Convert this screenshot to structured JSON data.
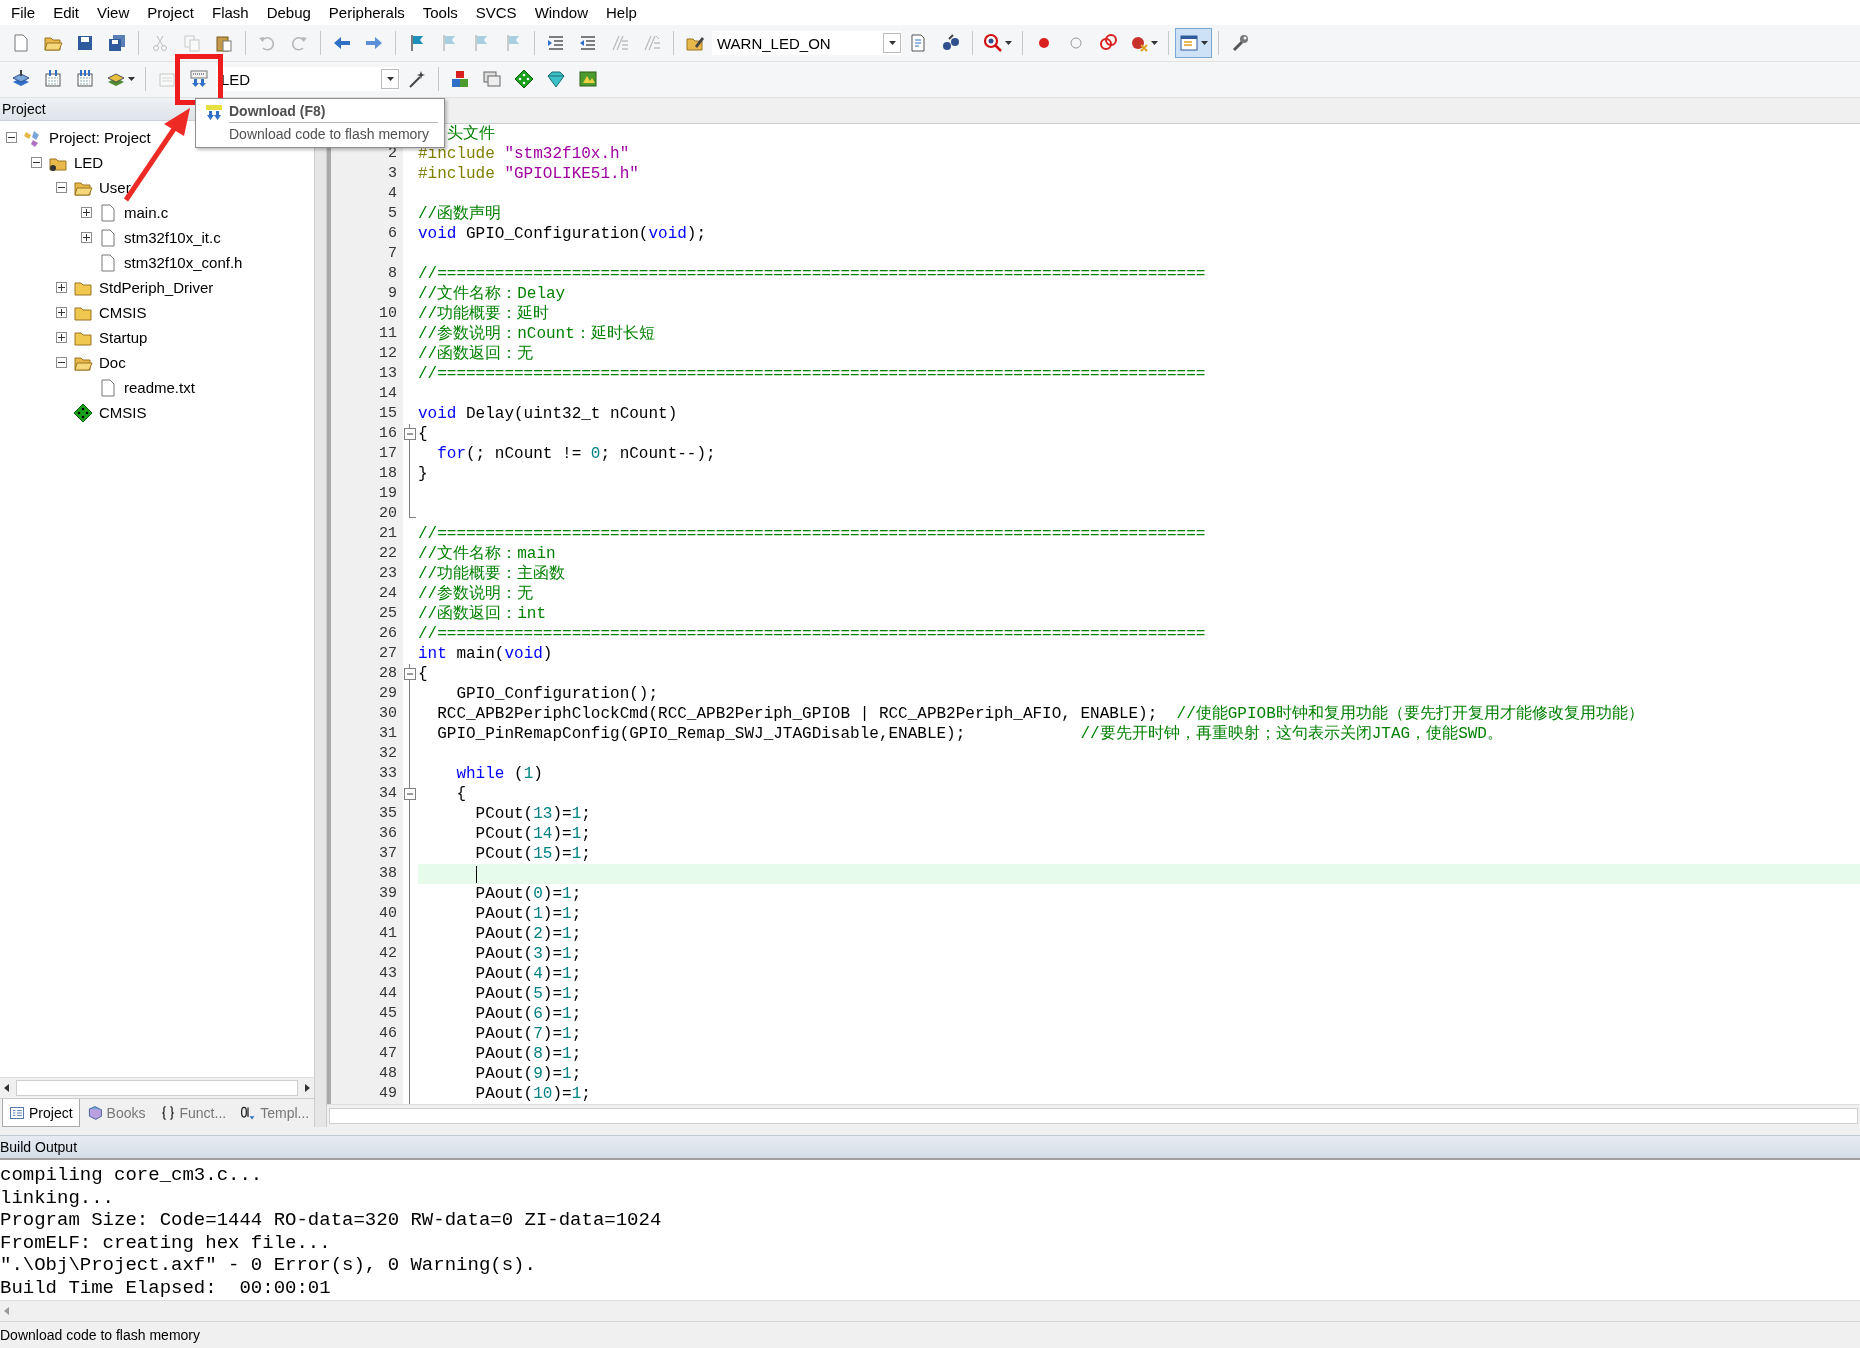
{
  "menu": [
    "File",
    "Edit",
    "View",
    "Project",
    "Flash",
    "Debug",
    "Peripherals",
    "Tools",
    "SVCS",
    "Window",
    "Help"
  ],
  "toolbar_1": [
    {
      "kind": "button",
      "disabled": false
    },
    {
      "kind": "button",
      "disabled": false
    },
    {
      "kind": "button",
      "disabled": false
    },
    {
      "kind": "button",
      "disabled": false
    },
    {
      "kind": "separator"
    },
    {
      "kind": "button",
      "disabled": true
    },
    {
      "kind": "button",
      "disabled": true
    },
    {
      "kind": "button",
      "disabled": false
    },
    {
      "kind": "separator"
    },
    {
      "kind": "button",
      "disabled": true
    },
    {
      "kind": "button",
      "disabled": true
    },
    {
      "kind": "separator"
    },
    {
      "kind": "button",
      "disabled": false
    },
    {
      "kind": "button",
      "disabled": false
    },
    {
      "kind": "separator"
    },
    {
      "kind": "button",
      "disabled": false
    },
    {
      "kind": "button",
      "disabled": true
    },
    {
      "kind": "button",
      "disabled": true
    },
    {
      "kind": "button",
      "disabled": true
    },
    {
      "kind": "separator"
    },
    {
      "kind": "button",
      "disabled": false
    },
    {
      "kind": "button",
      "disabled": false
    },
    {
      "kind": "button",
      "disabled": true
    },
    {
      "kind": "button",
      "disabled": true
    },
    {
      "kind": "separator"
    },
    {
      "kind": "button",
      "disabled": false
    },
    {
      "kind": "combo",
      "value": "WARN_LED_ON"
    },
    {
      "kind": "button",
      "disabled": false
    },
    {
      "kind": "button",
      "disabled": false
    },
    {
      "kind": "separator"
    },
    {
      "kind": "menu-button",
      "disabled": false
    },
    {
      "kind": "separator"
    },
    {
      "kind": "button",
      "disabled": false
    },
    {
      "kind": "button",
      "disabled": false
    },
    {
      "kind": "button",
      "disabled": false
    },
    {
      "kind": "menu-button",
      "disabled": false
    },
    {
      "kind": "separator"
    },
    {
      "kind": "menu-button",
      "disabled": false,
      "pressed": true
    },
    {
      "kind": "separator"
    },
    {
      "kind": "button",
      "disabled": false
    }
  ],
  "toolbar_2": [
    {
      "kind": "button",
      "disabled": false
    },
    {
      "kind": "button",
      "disabled": false
    },
    {
      "kind": "button",
      "disabled": false
    },
    {
      "kind": "menu-button",
      "disabled": false
    },
    {
      "kind": "separator"
    },
    {
      "kind": "button",
      "disabled": true
    },
    {
      "kind": "button",
      "disabled": false,
      "highlighted": true
    },
    {
      "kind": "combo",
      "value": "LED"
    },
    {
      "kind": "button",
      "disabled": false
    },
    {
      "kind": "separator"
    },
    {
      "kind": "button",
      "disabled": false
    },
    {
      "kind": "button",
      "disabled": false
    },
    {
      "kind": "button",
      "disabled": false
    },
    {
      "kind": "button",
      "disabled": false
    },
    {
      "kind": "button",
      "disabled": false
    }
  ],
  "tooltip": {
    "title": "Download (F8)",
    "description": "Download code to flash memory"
  },
  "annotation_arrow": true,
  "project_panel": {
    "title": "Project",
    "tree": [
      {
        "label": "Project: Project",
        "kind": "project",
        "expanded": true,
        "children": [
          {
            "label": "LED",
            "kind": "target",
            "expanded": true,
            "children": [
              {
                "label": "User",
                "kind": "group",
                "expanded": true,
                "children": [
                  {
                    "label": "main.c",
                    "kind": "file",
                    "expanded": false
                  },
                  {
                    "label": "stm32f10x_it.c",
                    "kind": "file",
                    "expanded": false
                  },
                  {
                    "label": "stm32f10x_conf.h",
                    "kind": "file"
                  }
                ]
              },
              {
                "label": "StdPeriph_Driver",
                "kind": "group",
                "expanded": false
              },
              {
                "label": "CMSIS",
                "kind": "group",
                "expanded": false
              },
              {
                "label": "Startup",
                "kind": "group",
                "expanded": false
              },
              {
                "label": "Doc",
                "kind": "group",
                "expanded": true,
                "children": [
                  {
                    "label": "readme.txt",
                    "kind": "file"
                  }
                ]
              },
              {
                "label": "CMSIS",
                "kind": "component"
              }
            ]
          }
        ]
      }
    ],
    "tabs": [
      {
        "label": "Project",
        "selected": true
      },
      {
        "label": "Books",
        "selected": false
      },
      {
        "label": "Funct...",
        "selected": false
      },
      {
        "label": "Templ...",
        "selected": false
      }
    ]
  },
  "editor": {
    "lines": [
      {
        "tokens": [
          {
            "kind": "comment",
            "text": "头文件"
          }
        ]
      },
      {
        "number": "2",
        "tokens": [
          {
            "kind": "preproc",
            "text": "#include"
          },
          {
            "kind": "string",
            "text": " \"stm32f10x.h\""
          }
        ]
      },
      {
        "number": "3",
        "tokens": [
          {
            "kind": "preproc",
            "text": "#include"
          },
          {
            "kind": "string",
            "text": " \"GPIOLIKE51.h\""
          }
        ]
      },
      {
        "number": "4"
      },
      {
        "number": "5",
        "tokens": [
          {
            "kind": "comment",
            "text": "//函数声明"
          }
        ]
      },
      {
        "number": "6",
        "tokens": [
          {
            "kind": "keyword",
            "text": "void"
          },
          {
            "kind": "plain",
            "text": " GPIO_Configuration("
          },
          {
            "kind": "keyword",
            "text": "void"
          },
          {
            "kind": "plain",
            "text": ");"
          }
        ]
      },
      {
        "number": "7"
      },
      {
        "number": "8",
        "tokens": [
          {
            "kind": "comment",
            "text": "//================================================================================"
          }
        ]
      },
      {
        "number": "9",
        "tokens": [
          {
            "kind": "comment",
            "text": "//文件名称：Delay"
          }
        ]
      },
      {
        "number": "10",
        "tokens": [
          {
            "kind": "comment",
            "text": "//功能概要：延时"
          }
        ]
      },
      {
        "number": "11",
        "tokens": [
          {
            "kind": "comment",
            "text": "//参数说明：nCount：延时长短"
          }
        ]
      },
      {
        "number": "12",
        "tokens": [
          {
            "kind": "comment",
            "text": "//函数返回：无"
          }
        ]
      },
      {
        "number": "13",
        "tokens": [
          {
            "kind": "comment",
            "text": "//================================================================================"
          }
        ]
      },
      {
        "number": "14"
      },
      {
        "number": "15",
        "tokens": [
          {
            "kind": "keyword",
            "text": "void"
          },
          {
            "kind": "plain",
            "text": " Delay(uint32_t nCount)"
          }
        ]
      },
      {
        "number": "16",
        "fold_toggle": true,
        "tokens": [
          {
            "kind": "plain",
            "text": "{"
          }
        ]
      },
      {
        "number": "17",
        "fold_guide": true,
        "tokens": [
          {
            "kind": "keyword",
            "text": "  for"
          },
          {
            "kind": "plain",
            "text": "(; nCount != "
          },
          {
            "kind": "number",
            "text": "0"
          },
          {
            "kind": "plain",
            "text": "; nCount--);"
          }
        ]
      },
      {
        "number": "18",
        "fold_guide": true,
        "tokens": [
          {
            "kind": "plain",
            "text": "}"
          }
        ]
      },
      {
        "number": "19",
        "fold_guide": true
      },
      {
        "number": "20",
        "fold_end": true
      },
      {
        "number": "21",
        "tokens": [
          {
            "kind": "comment",
            "text": "//================================================================================"
          }
        ]
      },
      {
        "number": "22",
        "tokens": [
          {
            "kind": "comment",
            "text": "//文件名称：main"
          }
        ]
      },
      {
        "number": "23",
        "tokens": [
          {
            "kind": "comment",
            "text": "//功能概要：主函数"
          }
        ]
      },
      {
        "number": "24",
        "tokens": [
          {
            "kind": "comment",
            "text": "//参数说明：无"
          }
        ]
      },
      {
        "number": "25",
        "tokens": [
          {
            "kind": "comment",
            "text": "//函数返回：int"
          }
        ]
      },
      {
        "number": "26",
        "tokens": [
          {
            "kind": "comment",
            "text": "//================================================================================"
          }
        ]
      },
      {
        "number": "27",
        "tokens": [
          {
            "kind": "keyword",
            "text": "int"
          },
          {
            "kind": "plain",
            "text": " main("
          },
          {
            "kind": "keyword",
            "text": "void"
          },
          {
            "kind": "plain",
            "text": ")"
          }
        ]
      },
      {
        "number": "28",
        "fold_toggle": true,
        "tokens": [
          {
            "kind": "plain",
            "text": "{"
          }
        ]
      },
      {
        "number": "29",
        "fold_guide": true,
        "tokens": [
          {
            "kind": "plain",
            "text": "    GPIO_Configuration();"
          }
        ]
      },
      {
        "number": "30",
        "fold_guide": true,
        "tokens": [
          {
            "kind": "plain",
            "text": "  RCC_APB2PeriphClockCmd(RCC_APB2Periph_GPIOB | RCC_APB2Periph_AFIO, ENABLE);  "
          },
          {
            "kind": "comment",
            "text": "//使能GPIOB时钟和复用功能（要先打开复用才能修改复用功能）"
          }
        ]
      },
      {
        "number": "31",
        "fold_guide": true,
        "tokens": [
          {
            "kind": "plain",
            "text": "  GPIO_PinRemapConfig(GPIO_Remap_SWJ_JTAGDisable,ENABLE);            "
          },
          {
            "kind": "comment",
            "text": "//要先开时钟，再重映射；这句表示关闭JTAG，使能SWD。"
          }
        ]
      },
      {
        "number": "32",
        "fold_guide": true
      },
      {
        "number": "33",
        "fold_guide": true,
        "tokens": [
          {
            "kind": "keyword",
            "text": "    while"
          },
          {
            "kind": "plain",
            "text": " ("
          },
          {
            "kind": "number",
            "text": "1"
          },
          {
            "kind": "plain",
            "text": ")"
          }
        ]
      },
      {
        "number": "34",
        "fold_toggle": true,
        "tokens": [
          {
            "kind": "plain",
            "text": "    {"
          }
        ]
      },
      {
        "number": "35",
        "fold_guide": true,
        "tokens": [
          {
            "kind": "plain",
            "text": "      PCout("
          },
          {
            "kind": "number",
            "text": "13"
          },
          {
            "kind": "plain",
            "text": ")="
          },
          {
            "kind": "number",
            "text": "1"
          },
          {
            "kind": "plain",
            "text": ";"
          }
        ]
      },
      {
        "number": "36",
        "fold_guide": true,
        "tokens": [
          {
            "kind": "plain",
            "text": "      PCout("
          },
          {
            "kind": "number",
            "text": "14"
          },
          {
            "kind": "plain",
            "text": ")="
          },
          {
            "kind": "number",
            "text": "1"
          },
          {
            "kind": "plain",
            "text": ";"
          }
        ]
      },
      {
        "number": "37",
        "fold_guide": true,
        "tokens": [
          {
            "kind": "plain",
            "text": "      PCout("
          },
          {
            "kind": "number",
            "text": "15"
          },
          {
            "kind": "plain",
            "text": ")="
          },
          {
            "kind": "number",
            "text": "1"
          },
          {
            "kind": "plain",
            "text": ";"
          }
        ]
      },
      {
        "number": "38",
        "fold_guide": true,
        "current": true
      },
      {
        "number": "39",
        "fold_guide": true,
        "tokens": [
          {
            "kind": "plain",
            "text": "      PAout("
          },
          {
            "kind": "number",
            "text": "0"
          },
          {
            "kind": "plain",
            "text": ")="
          },
          {
            "kind": "number",
            "text": "1"
          },
          {
            "kind": "plain",
            "text": ";"
          }
        ]
      },
      {
        "number": "40",
        "fold_guide": true,
        "tokens": [
          {
            "kind": "plain",
            "text": "      PAout("
          },
          {
            "kind": "number",
            "text": "1"
          },
          {
            "kind": "plain",
            "text": ")="
          },
          {
            "kind": "number",
            "text": "1"
          },
          {
            "kind": "plain",
            "text": ";"
          }
        ]
      },
      {
        "number": "41",
        "fold_guide": true,
        "tokens": [
          {
            "kind": "plain",
            "text": "      PAout("
          },
          {
            "kind": "number",
            "text": "2"
          },
          {
            "kind": "plain",
            "text": ")="
          },
          {
            "kind": "number",
            "text": "1"
          },
          {
            "kind": "plain",
            "text": ";"
          }
        ]
      },
      {
        "number": "42",
        "fold_guide": true,
        "tokens": [
          {
            "kind": "plain",
            "text": "      PAout("
          },
          {
            "kind": "number",
            "text": "3"
          },
          {
            "kind": "plain",
            "text": ")="
          },
          {
            "kind": "number",
            "text": "1"
          },
          {
            "kind": "plain",
            "text": ";"
          }
        ]
      },
      {
        "number": "43",
        "fold_guide": true,
        "tokens": [
          {
            "kind": "plain",
            "text": "      PAout("
          },
          {
            "kind": "number",
            "text": "4"
          },
          {
            "kind": "plain",
            "text": ")="
          },
          {
            "kind": "number",
            "text": "1"
          },
          {
            "kind": "plain",
            "text": ";"
          }
        ]
      },
      {
        "number": "44",
        "fold_guide": true,
        "tokens": [
          {
            "kind": "plain",
            "text": "      PAout("
          },
          {
            "kind": "number",
            "text": "5"
          },
          {
            "kind": "plain",
            "text": ")="
          },
          {
            "kind": "number",
            "text": "1"
          },
          {
            "kind": "plain",
            "text": ";"
          }
        ]
      },
      {
        "number": "45",
        "fold_guide": true,
        "tokens": [
          {
            "kind": "plain",
            "text": "      PAout("
          },
          {
            "kind": "number",
            "text": "6"
          },
          {
            "kind": "plain",
            "text": ")="
          },
          {
            "kind": "number",
            "text": "1"
          },
          {
            "kind": "plain",
            "text": ";"
          }
        ]
      },
      {
        "number": "46",
        "fold_guide": true,
        "tokens": [
          {
            "kind": "plain",
            "text": "      PAout("
          },
          {
            "kind": "number",
            "text": "7"
          },
          {
            "kind": "plain",
            "text": ")="
          },
          {
            "kind": "number",
            "text": "1"
          },
          {
            "kind": "plain",
            "text": ";"
          }
        ]
      },
      {
        "number": "47",
        "fold_guide": true,
        "tokens": [
          {
            "kind": "plain",
            "text": "      PAout("
          },
          {
            "kind": "number",
            "text": "8"
          },
          {
            "kind": "plain",
            "text": ")="
          },
          {
            "kind": "number",
            "text": "1"
          },
          {
            "kind": "plain",
            "text": ";"
          }
        ]
      },
      {
        "number": "48",
        "fold_guide": true,
        "tokens": [
          {
            "kind": "plain",
            "text": "      PAout("
          },
          {
            "kind": "number",
            "text": "9"
          },
          {
            "kind": "plain",
            "text": ")="
          },
          {
            "kind": "number",
            "text": "1"
          },
          {
            "kind": "plain",
            "text": ";"
          }
        ]
      },
      {
        "number": "49",
        "fold_guide": true,
        "tokens": [
          {
            "kind": "plain",
            "text": "      PAout("
          },
          {
            "kind": "number",
            "text": "10"
          },
          {
            "kind": "plain",
            "text": ")="
          },
          {
            "kind": "number",
            "text": "1"
          },
          {
            "kind": "plain",
            "text": ";"
          }
        ]
      }
    ]
  },
  "build_output": {
    "title": "Build Output",
    "lines": [
      "compiling core_cm3.c...",
      "linking...",
      "Program Size: Code=1444 RO-data=320 RW-data=0 ZI-data=1024",
      "FromELF: creating hex file...",
      "\".\\Obj\\Project.axf\" - 0 Error(s), 0 Warning(s).",
      "Build Time Elapsed:  00:00:01"
    ]
  },
  "status_bar": "Download code to flash memory"
}
